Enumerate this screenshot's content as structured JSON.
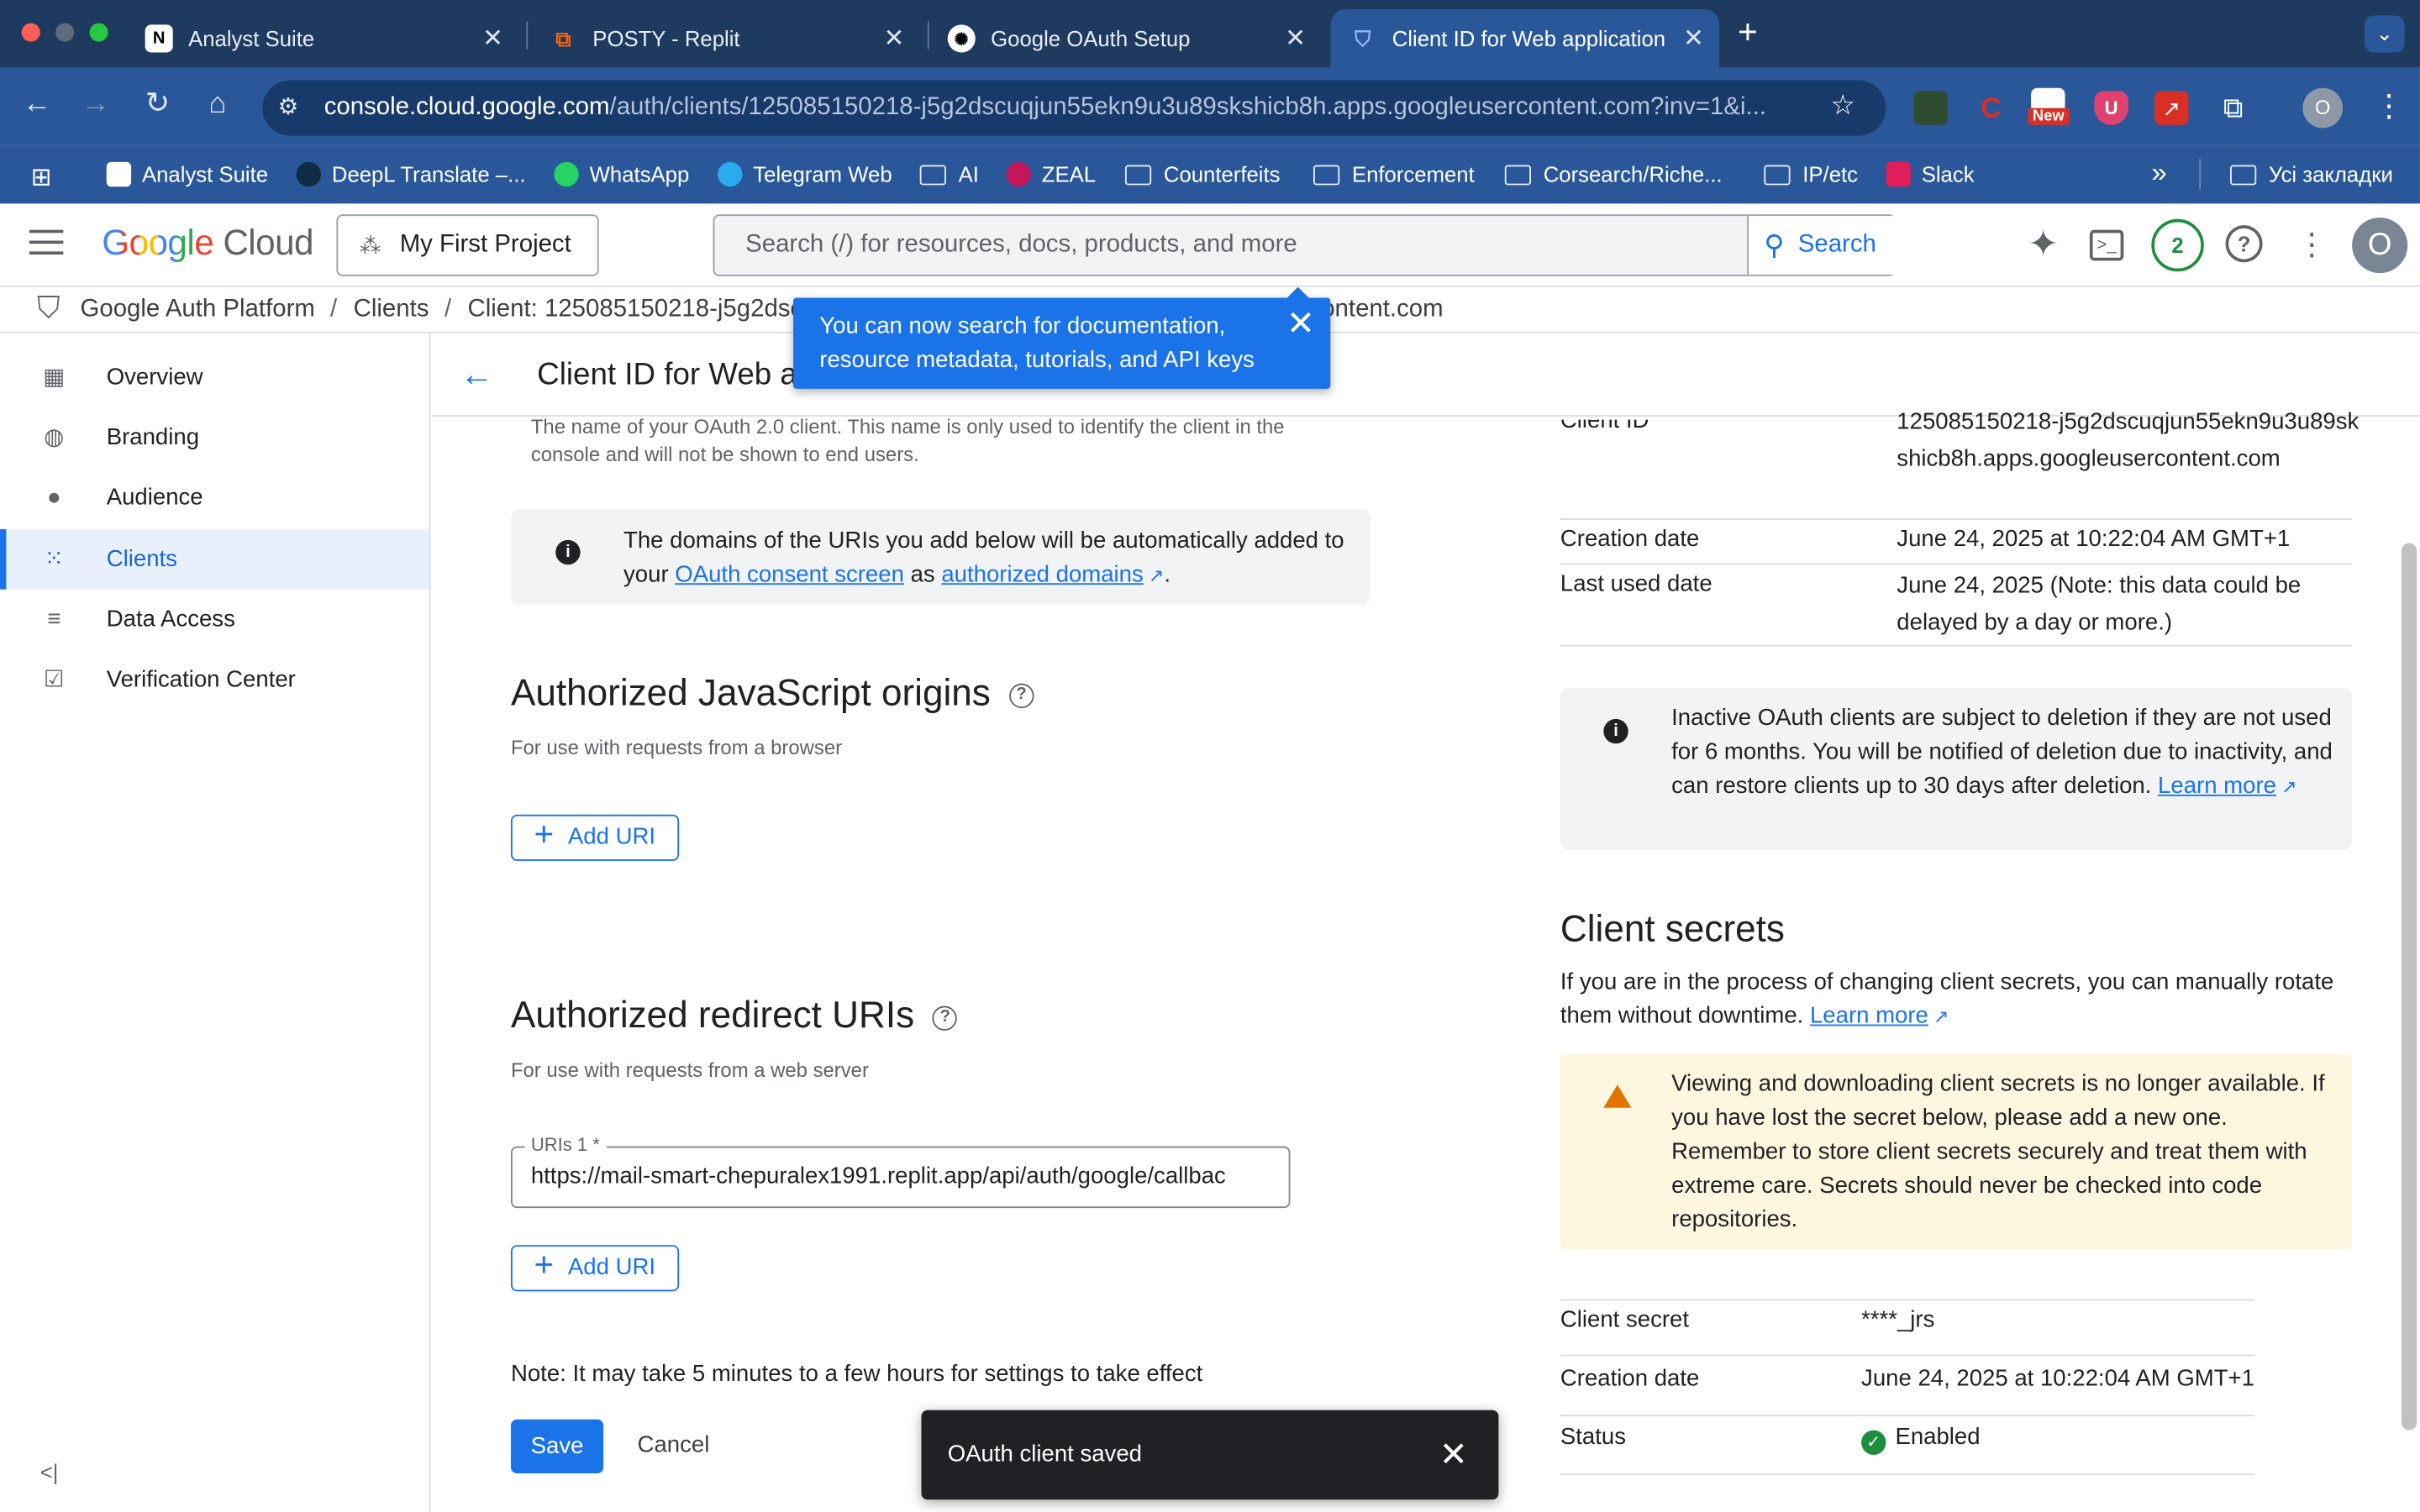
{
  "browser": {
    "tabs": [
      {
        "label": "Analyst Suite",
        "icon": "notion-icon"
      },
      {
        "label": "POSTY - Replit",
        "icon": "replit-icon"
      },
      {
        "label": "Google OAuth Setup",
        "icon": "openai-icon"
      },
      {
        "label": "Client ID for Web application",
        "icon": "shield-icon"
      }
    ],
    "new_tab": "+",
    "url_host": "console.cloud.google.com",
    "url_path": "/auth/clients/125085150218-j5g2dscuqjun55ekn9u3u89skshicb8h.apps.googleusercontent.com?inv=1&i...",
    "new_badge": "New",
    "profile_initial": "O",
    "bookmarks": [
      {
        "label": "Analyst Suite",
        "icon": "notion-icon"
      },
      {
        "label": "DeepL Translate –...",
        "icon": "deepl-icon"
      },
      {
        "label": "WhatsApp",
        "icon": "whatsapp-icon"
      },
      {
        "label": "Telegram Web",
        "icon": "telegram-icon"
      },
      {
        "label": "AI",
        "icon": "folder-icon"
      },
      {
        "label": "ZEAL",
        "icon": "zeal-icon"
      },
      {
        "label": "Counterfeits",
        "icon": "folder-icon"
      },
      {
        "label": "Enforcement",
        "icon": "folder-icon"
      },
      {
        "label": "Corsearch/Riche...",
        "icon": "folder-icon"
      },
      {
        "label": "IP/etc",
        "icon": "folder-icon"
      },
      {
        "label": "Slack",
        "icon": "slack-icon"
      }
    ],
    "bookmarks_more": "»",
    "all_bookmarks": "Усі закладки"
  },
  "gcp": {
    "logo_google": "Google",
    "logo_cloud": "Cloud",
    "project": "My First Project",
    "search_placeholder": "Search (/) for resources, docs, products, and more",
    "search_button": "Search",
    "notifications": "2",
    "avatar": "O"
  },
  "breadcrumb": {
    "root": "Google Auth Platform",
    "sep": "/",
    "clients": "Clients",
    "current": "Client: 125085150218-j5g2dsc",
    "current_tail": "ontent.com"
  },
  "sidebar": {
    "items": [
      {
        "label": "Overview",
        "icon": "dashboard-icon"
      },
      {
        "label": "Branding",
        "icon": "palette-icon"
      },
      {
        "label": "Audience",
        "icon": "person-icon"
      },
      {
        "label": "Clients",
        "icon": "apps-grid-icon"
      },
      {
        "label": "Data Access",
        "icon": "data-access-icon"
      },
      {
        "label": "Verification Center",
        "icon": "verified-icon"
      }
    ],
    "collapse": "<|"
  },
  "page": {
    "title": "Client ID for Web a",
    "name_help": "The name of your OAuth 2.0 client. This name is only used to identify the client in the console and will not be shown to end users.",
    "domains_info_1": "The domains of the URIs you add below will be automatically added to your",
    "domains_link_1": "OAuth consent screen",
    "domains_as": "as",
    "domains_link_2": "authorized domains",
    "domains_end": ".",
    "js_origins_title": "Authorized JavaScript origins",
    "js_origins_sub": "For use with requests from a browser",
    "add_uri": "Add URI",
    "redirect_title": "Authorized redirect URIs",
    "redirect_sub": "For use with requests from a web server",
    "uri_label": "URIs 1 *",
    "uri_value": "https://mail-smart-chepuralex1991.replit.app/api/auth/google/callbac",
    "note": "Note: It may take 5 minutes to a few hours for settings to take effect",
    "save": "Save",
    "cancel": "Cancel"
  },
  "right": {
    "client_id_label": "Client ID",
    "client_id_value": "125085150218-j5g2dscuqjun55ekn9u3u89skshicb8h.apps.googleusercontent.com",
    "creation_label": "Creation date",
    "creation_value": "June 24, 2025 at 10:22:04 AM GMT+1",
    "last_used_label": "Last used date",
    "last_used_value": "June 24, 2025 (Note: this data could be delayed by a day or more.)",
    "inactive_info": "Inactive OAuth clients are subject to deletion if they are not used for 6 months. You will be notified of deletion due to inactivity, and can restore clients up to 30 days after deletion.",
    "learn_more": "Learn more",
    "secrets_title": "Client secrets",
    "secrets_desc": "If you are in the process of changing client secrets, you can manually rotate them without downtime.",
    "warning": "Viewing and downloading client secrets is no longer available. If you have lost the secret below, please add a new one. Remember to store client secrets securely and treat them with extreme care. Secrets should never be checked into code repositories.",
    "secret_label": "Client secret",
    "secret_value": "****_jrs",
    "secret_creation_label": "Creation date",
    "secret_creation_value": "June 24, 2025 at 10:22:04 AM GMT+1",
    "status_label": "Status",
    "status_value": "Enabled"
  },
  "tooltip": {
    "text": "You can now search for documentation, resource metadata, tutorials, and API keys"
  },
  "toast": {
    "text": "OAuth client saved"
  },
  "colors": {
    "accent": "#1a73e8",
    "chrome": "#2a5799",
    "warning_bg": "#fef7e0",
    "enabled": "#1e8e3e"
  }
}
